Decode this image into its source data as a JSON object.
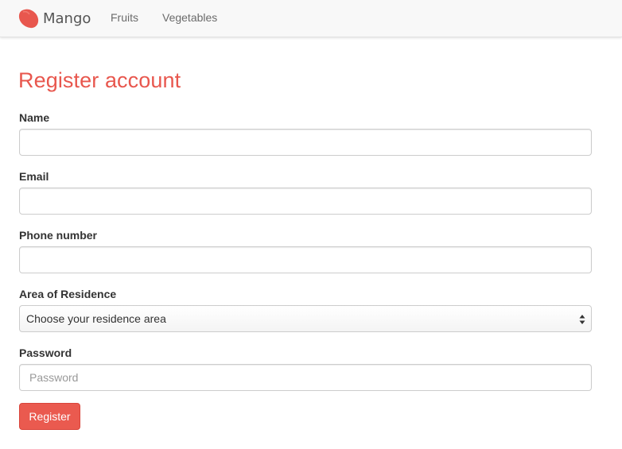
{
  "navbar": {
    "brand_icon": "mango-logo-icon",
    "brand_name": "Mango",
    "links": [
      {
        "label": "Fruits"
      },
      {
        "label": "Vegetables"
      }
    ]
  },
  "form": {
    "title": "Register account",
    "fields": {
      "name": {
        "label": "Name",
        "value": "",
        "placeholder": ""
      },
      "email": {
        "label": "Email",
        "value": "",
        "placeholder": ""
      },
      "phone": {
        "label": "Phone number",
        "value": "",
        "placeholder": ""
      },
      "area": {
        "label": "Area of Residence",
        "selected": "Choose your residence area"
      },
      "password": {
        "label": "Password",
        "value": "",
        "placeholder": "Password"
      }
    },
    "submit_label": "Register"
  },
  "colors": {
    "accent": "#e8574e",
    "button": "#ea5a4f",
    "navbar_bg": "#f8f8f8"
  }
}
